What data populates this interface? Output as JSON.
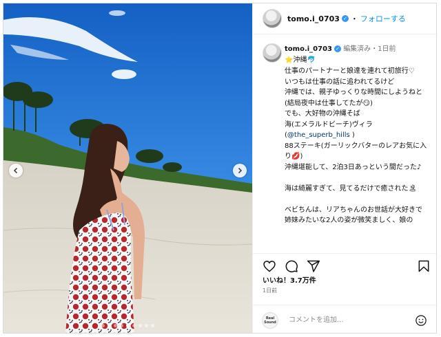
{
  "post": {
    "username": "tomo.i_0703",
    "follow_label": "フォローする",
    "separator": "・",
    "caption": {
      "edited_label": "編集済み",
      "time_ago": "1日前",
      "line1": "⭐️沖縄🐬",
      "body_before_mention": "仕事のパートナーと娘達を連れて初旅行♡\nいつもは仕事の話に追われてるけど\n沖縄では、親子ゆっくりな時間にしようねと(結局夜中は仕事してたが😏)\nでも、大好物の沖縄そば\n海(エメラルドビーチ)ヴィラ(",
      "mention": "@the_superb_hills",
      "body_after_mention": " )\n88ステーキ(ガーリックバターのレアお気に入り💋)\n沖縄堪能して、2泊3日あっという間だった♪\n\n海は綺麗すぎて、見てるだけで癒された🏝\n\nベビちんは、リアちゃんのお世話が大好きで\n姉妹みたいな2人の姿が微笑ましく、娘の"
    },
    "likes": "いいね！3.7万件",
    "date": "1日前"
  },
  "icons": {
    "like": "heart-icon",
    "comment": "comment-icon",
    "share": "share-icon",
    "save": "bookmark-icon",
    "emoji": "emoji-icon",
    "prev": "chevron-left-icon",
    "next": "chevron-right-icon",
    "verified": "verified-badge-icon"
  },
  "comment_box": {
    "placeholder": "コメントを追加...",
    "brand_avatar_line1": "Real",
    "brand_avatar_line2": "Sound"
  },
  "carousel": {
    "total": 9,
    "current": 5
  },
  "colors": {
    "link": "#0095f6",
    "verified": "#3897f0",
    "mention": "#00376b"
  }
}
